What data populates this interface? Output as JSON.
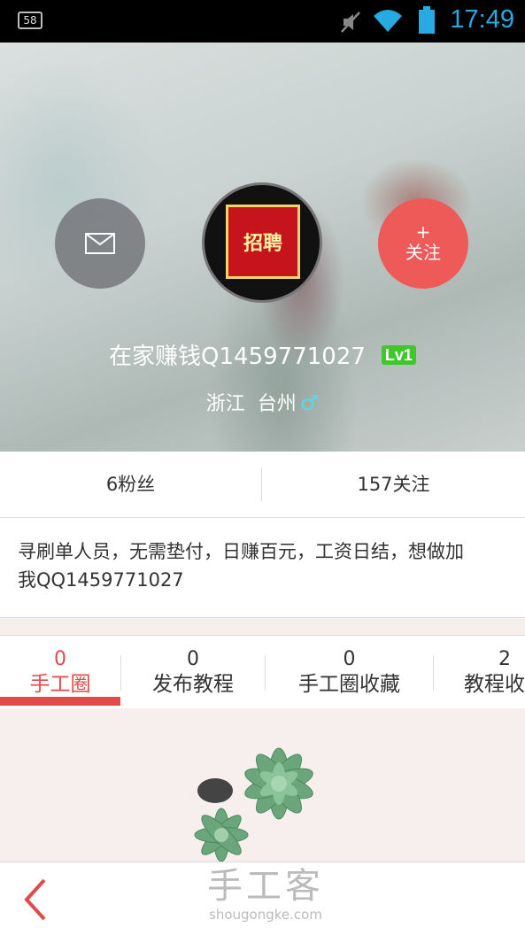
{
  "status_bar": {
    "notification_count": "58",
    "time": "17:49"
  },
  "profile": {
    "username": "在家赚钱Q1459771027",
    "level_badge": "Lv1",
    "location": "浙江  台州",
    "gender_symbol": "♂",
    "follow_button": {
      "plus": "+",
      "label": "关注"
    },
    "avatar_text": "招聘"
  },
  "stats": {
    "fans": "6粉丝",
    "following": "157关注"
  },
  "bio": "寻刷单人员，无需垫付，日赚百元，工资日结，想做加我QQ1459771027",
  "tabs": [
    {
      "count": "0",
      "label": "手工圈",
      "active": true
    },
    {
      "count": "0",
      "label": "发布教程"
    },
    {
      "count": "0",
      "label": "手工圈收藏"
    },
    {
      "count": "2",
      "label": "教程收藏"
    }
  ],
  "bottom_bar": {
    "watermark_title": "手工客",
    "watermark_url": "shougongke.com"
  },
  "colors": {
    "accent": "#e04a4a",
    "follow": "#ee5a57",
    "level": "#3ec82a",
    "time": "#27a9e1"
  }
}
